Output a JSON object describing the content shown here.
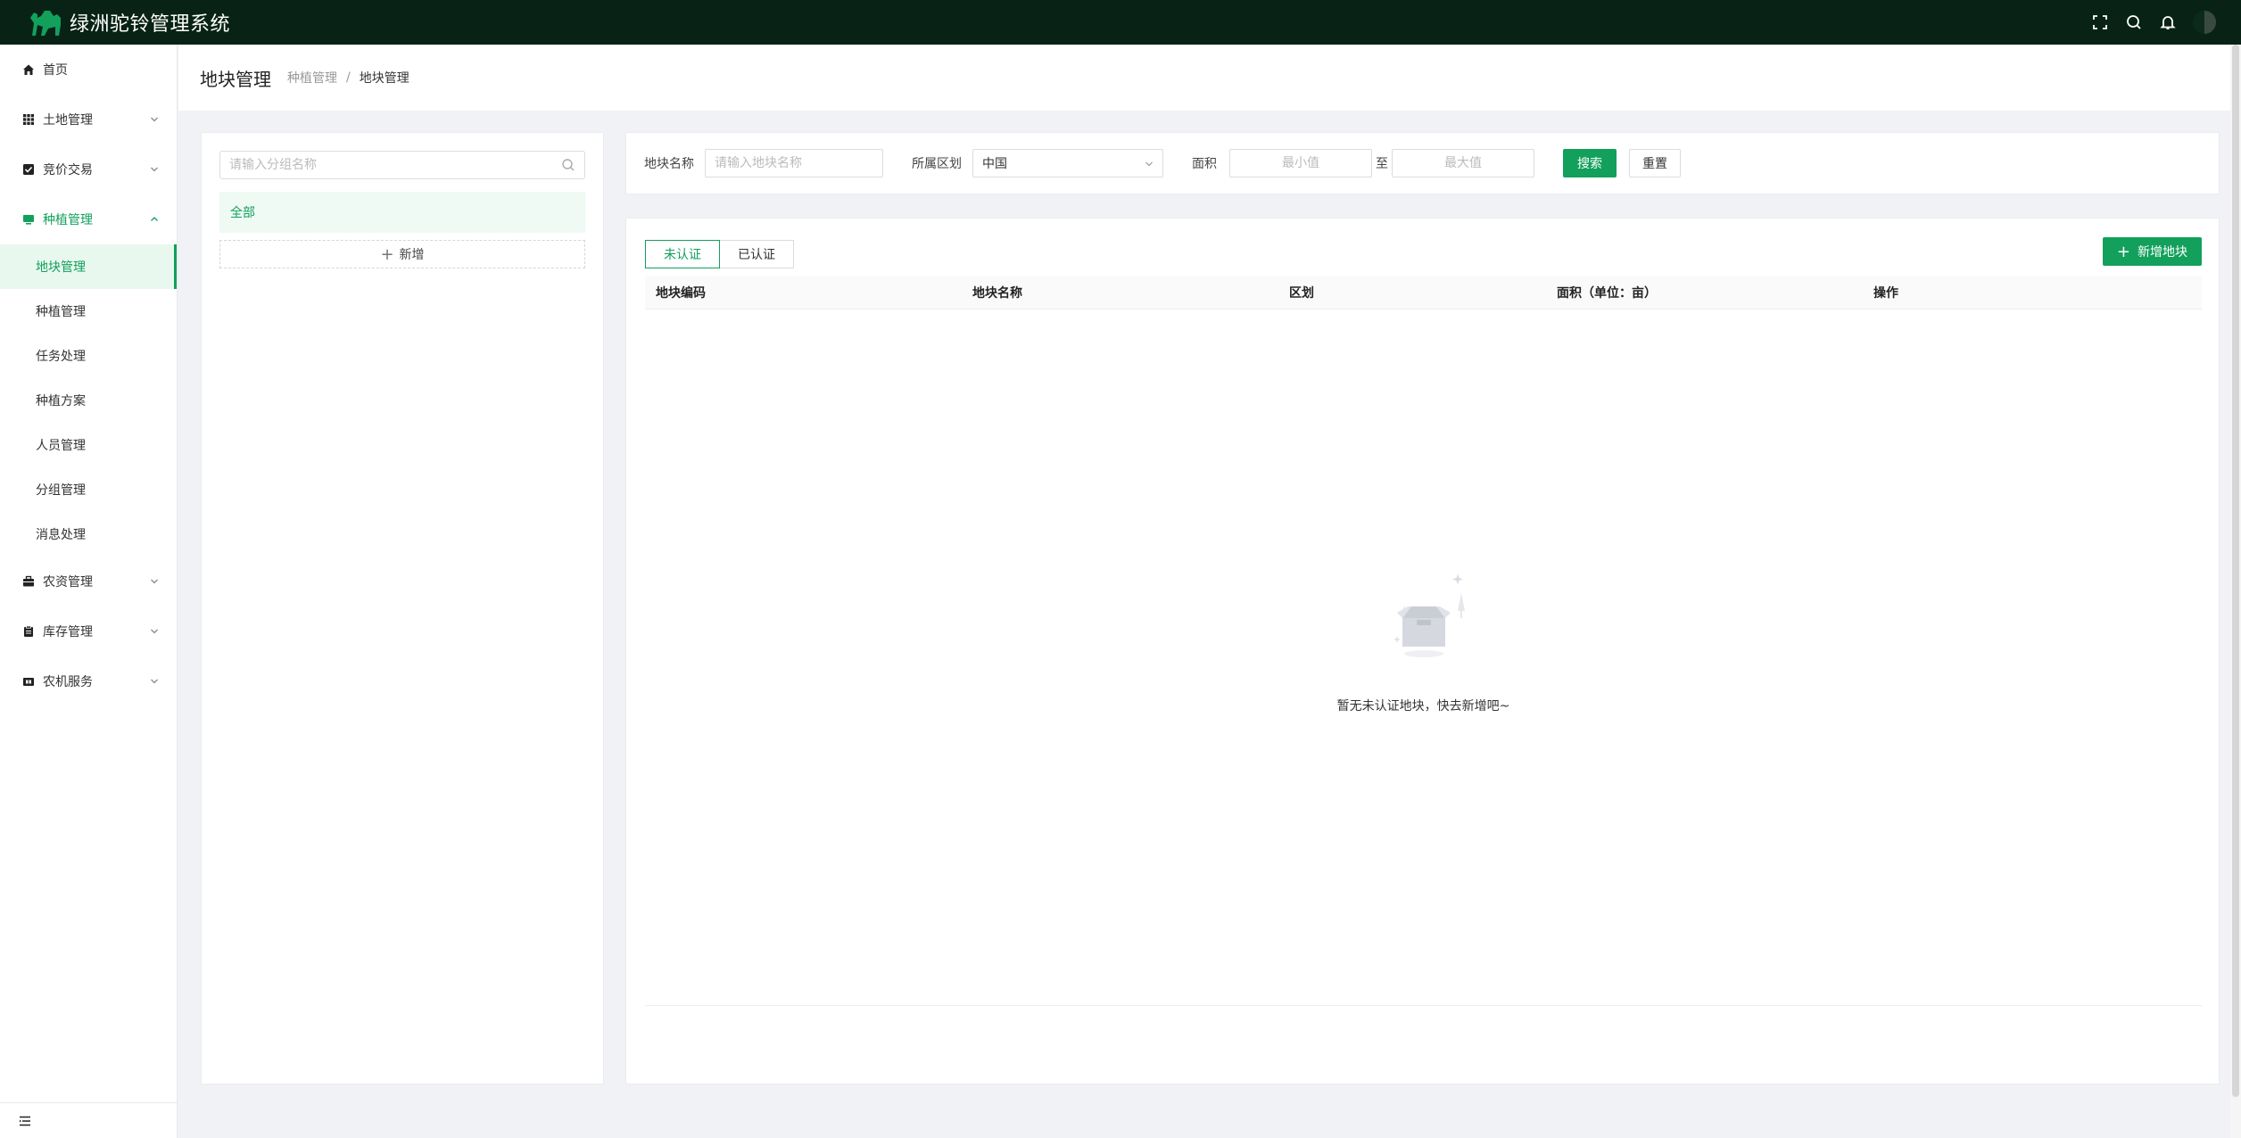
{
  "app": {
    "title": "绿洲驼铃管理系统"
  },
  "header_icons": [
    "fullscreen-icon",
    "search-icon",
    "bell-icon",
    "user-avatar"
  ],
  "sidebar": {
    "items": [
      {
        "label": "首页",
        "icon": "home-icon"
      },
      {
        "label": "土地管理",
        "icon": "grid-icon"
      },
      {
        "label": "竞价交易",
        "icon": "check-square-icon"
      },
      {
        "label": "种植管理",
        "icon": "monitor-icon",
        "open": true,
        "children": [
          {
            "label": "地块管理",
            "active": true
          },
          {
            "label": "种植管理"
          },
          {
            "label": "任务处理"
          },
          {
            "label": "种植方案"
          },
          {
            "label": "人员管理"
          },
          {
            "label": "分组管理"
          },
          {
            "label": "消息处理"
          }
        ]
      },
      {
        "label": "农资管理",
        "icon": "briefcase-icon"
      },
      {
        "label": "库存管理",
        "icon": "clipboard-icon"
      },
      {
        "label": "农机服务",
        "icon": "machine-icon"
      }
    ]
  },
  "page": {
    "title": "地块管理",
    "breadcrumb": [
      "种植管理",
      "/",
      "地块管理"
    ]
  },
  "group_panel": {
    "search_placeholder": "请输入分组名称",
    "all_label": "全部",
    "add_label": "新增"
  },
  "filter": {
    "name_label": "地块名称",
    "name_placeholder": "请输入地块名称",
    "region_label": "所属区划",
    "region_value": "中国",
    "area_label": "面积",
    "min_placeholder": "最小值",
    "range_sep": "至",
    "max_placeholder": "最大值",
    "search_btn": "搜索",
    "reset_btn": "重置"
  },
  "table": {
    "tabs": [
      "未认证",
      "已认证"
    ],
    "active_tab": "未认证",
    "add_btn": "新增地块",
    "columns": [
      "地块编码",
      "地块名称",
      "区划",
      "面积（单位：亩）",
      "操作"
    ],
    "rows": [],
    "empty_text": "暂无未认证地块，快去新增吧~"
  },
  "colors": {
    "primary": "#12a05c",
    "topbar": "#082316",
    "active_bg": "#e9f8ef"
  }
}
